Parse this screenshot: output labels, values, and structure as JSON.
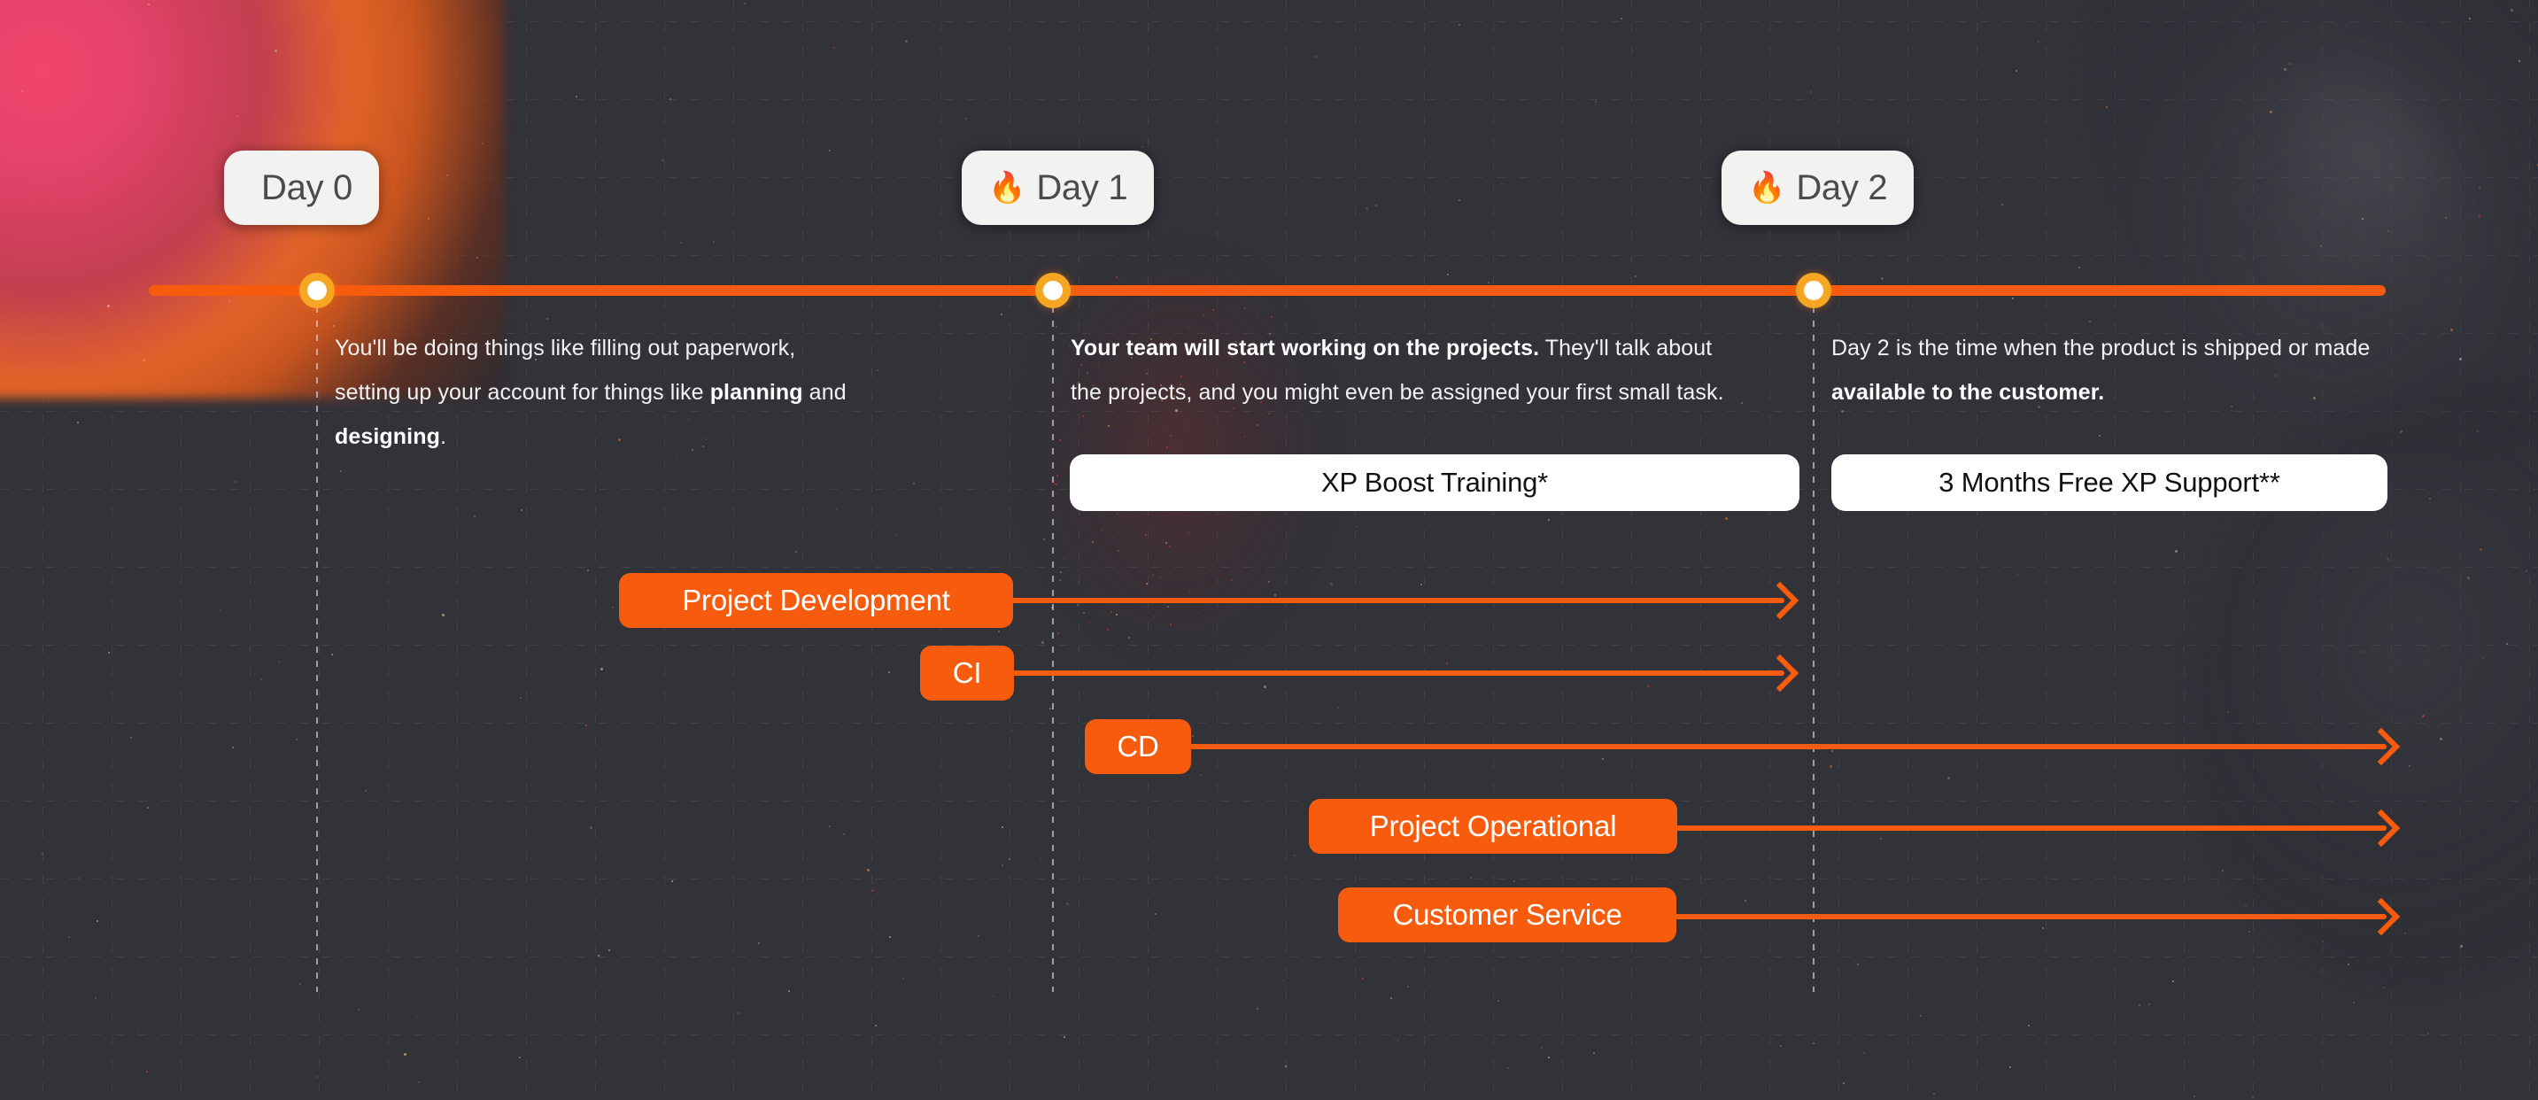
{
  "theme": {
    "background": "#0a0a12",
    "accent_orange": "#f75c0e",
    "marker_ring": "#f5a623",
    "pill_bg": "#f2f2f1",
    "pill_text": "#4b4b4b",
    "banner_bg": "#ffffff",
    "banner_text": "#111114",
    "body_text": "#f2f2f2"
  },
  "timeline": {
    "milestones": [
      {
        "id": "day-0",
        "emoji": "",
        "label": "Day 0"
      },
      {
        "id": "day-1",
        "emoji": "🔥",
        "label": "Day 1"
      },
      {
        "id": "day-2",
        "emoji": "🔥",
        "label": "Day 2"
      }
    ]
  },
  "descriptions": [
    {
      "id": "day-0-desc",
      "segments": [
        {
          "text": "You'll be doing things like filling out paperwork, setting up your account for things like ",
          "bold": false
        },
        {
          "text": "planning",
          "bold": true
        },
        {
          "text": " and ",
          "bold": false
        },
        {
          "text": "designing",
          "bold": true
        },
        {
          "text": ".",
          "bold": false
        }
      ]
    },
    {
      "id": "day-1-desc",
      "segments": [
        {
          "text": "Your team will start working on the projects.",
          "bold": true
        },
        {
          "text": "  They'll talk about the projects, and you might even be assigned your first small task.",
          "bold": false
        }
      ]
    },
    {
      "id": "day-2-desc",
      "segments": [
        {
          "text": "Day 2 is the time when the product is shipped or made ",
          "bold": false
        },
        {
          "text": "available to the customer.",
          "bold": true
        }
      ]
    }
  ],
  "banners": [
    {
      "id": "xp-boost-training",
      "label": "XP Boost Training*"
    },
    {
      "id": "xp-support",
      "label": "3 Months Free XP Support**"
    }
  ],
  "tasks": [
    {
      "id": "project-development",
      "label": "Project Development"
    },
    {
      "id": "ci",
      "label": "CI"
    },
    {
      "id": "cd",
      "label": "CD"
    },
    {
      "id": "project-operational",
      "label": "Project Operational"
    },
    {
      "id": "customer-service",
      "label": "Customer Service"
    }
  ]
}
